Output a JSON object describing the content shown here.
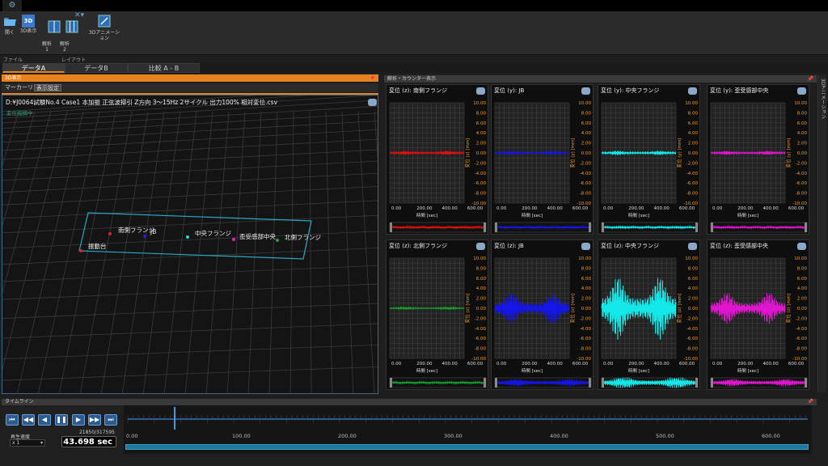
{
  "ribbon": {
    "buttons": [
      {
        "label": "開く",
        "icon": "folder-open-icon"
      },
      {
        "label": "3D表示",
        "icon": "3d-icon"
      },
      {
        "label": "解析\n1",
        "icon": "analysis-1-icon"
      },
      {
        "label": "解析\n2",
        "icon": "analysis-2-icon"
      },
      {
        "label": "",
        "icon": "close-dropdown-icon"
      },
      {
        "label": "3Dアニメーション",
        "icon": "animation-icon"
      }
    ],
    "group_file": "ファイル",
    "group_layout": "レイアウト",
    "icon_3d_text": "3D"
  },
  "tabs": [
    "データA",
    "データB",
    "比較 A - B"
  ],
  "panel3d": {
    "header": "3D表示",
    "marker_list": "マーカーリスト",
    "display_settings": "表示設定",
    "file_path": "D:¥J0064試験No.4 Case1 本加振 正弦波掃引 Z方向 3～15Hz 2サイクル 出力100% 相対変位.csv",
    "status": "変位指摘中",
    "labels": [
      "南側フランジ",
      "JB",
      "中央フランジ",
      "歪受感部中央",
      "北側フランジ",
      "振動台"
    ]
  },
  "analysis": {
    "header": "解析・カウンター表示",
    "right_strip": "3Dアニメーション",
    "yticks": [
      "10.00",
      "8.00",
      "6.00",
      "4.00",
      "2.00",
      "0.00",
      "-2.00",
      "-4.00",
      "-6.00",
      "-8.00",
      "-10.00"
    ],
    "xticks": [
      "0.00",
      "200.00",
      "400.00",
      "600.00"
    ],
    "xlabel": "時間 [sec]",
    "charts": [
      {
        "title": "変位 (z): 南側フランジ",
        "ylabel": "変位 (z) [mm]",
        "color": "#e01010",
        "amp": 0.3
      },
      {
        "title": "変位 (y): JB",
        "ylabel": "変位 (y) [mm]",
        "color": "#1515e8",
        "amp": 0.25
      },
      {
        "title": "変位 (y): 中央フランジ",
        "ylabel": "変位 (y) [mm]",
        "color": "#15e8e8",
        "amp": 0.35
      },
      {
        "title": "変位 (y): 歪受感部中央",
        "ylabel": "変位 (y) [mm]",
        "color": "#e015d0",
        "amp": 0.3
      },
      {
        "title": "変位 (z): 北側フランジ",
        "ylabel": "変位 (z) [mm]",
        "color": "#15a030",
        "amp": 0.2
      },
      {
        "title": "変位 (z): JB",
        "ylabel": "変位 (z) [mm]",
        "color": "#1515e8",
        "amp": 2.6
      },
      {
        "title": "変位 (z): 中央フランジ",
        "ylabel": "変位 (z) [mm]",
        "color": "#15e8e8",
        "amp": 5.2
      },
      {
        "title": "変位 (z): 歪受感部中央",
        "ylabel": "変位 (z) [mm]",
        "color": "#e015d0",
        "amp": 2.6
      }
    ]
  },
  "timeline": {
    "header": "タイムライン",
    "speed_label": "再生速度",
    "speed_value": "x 1",
    "frame": "21850/317595",
    "time": "43.698 sec",
    "ticks": [
      "0.00",
      "100.00",
      "200.00",
      "300.00",
      "400.00",
      "500.00",
      "600.00"
    ],
    "current_fraction": 0.069
  },
  "colors": {
    "accent": "#e8821e",
    "play": "#2c5b8f"
  }
}
